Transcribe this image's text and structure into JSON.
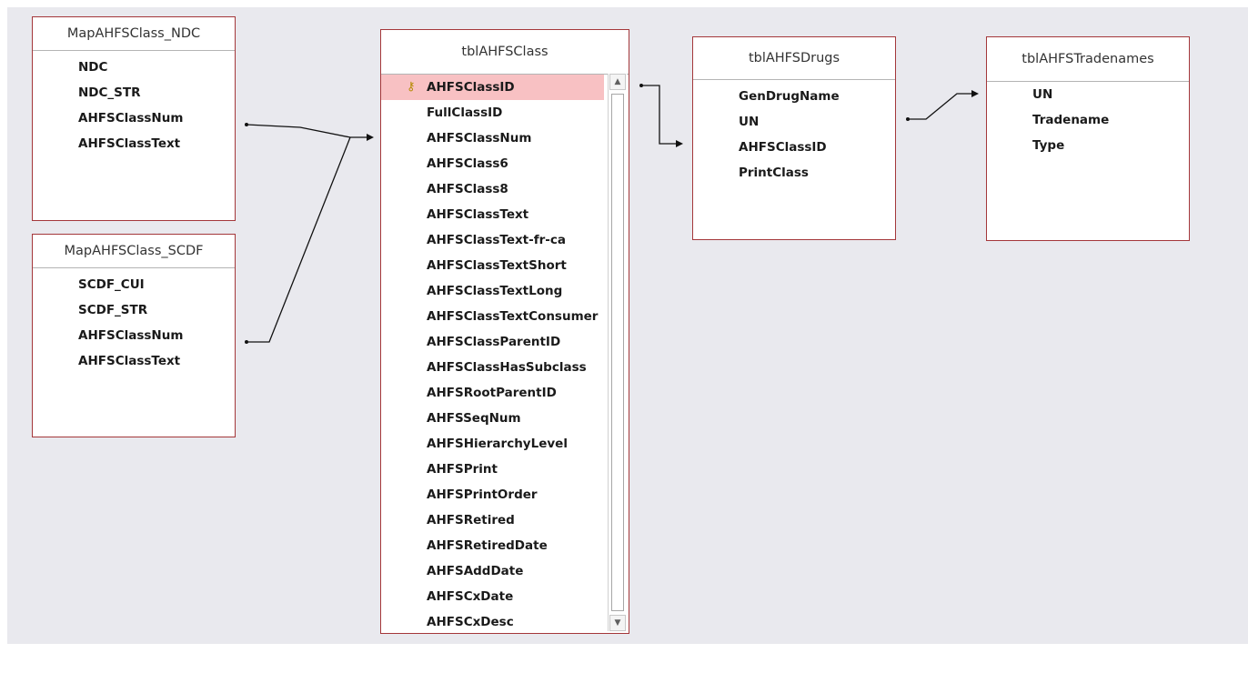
{
  "tables": {
    "map_ndc": {
      "title": "MapAHFSClass_NDC",
      "fields": [
        "NDC",
        "NDC_STR",
        "AHFSClassNum",
        "AHFSClassText"
      ]
    },
    "map_scdf": {
      "title": "MapAHFSClass_SCDF",
      "fields": [
        "SCDF_CUI",
        "SCDF_STR",
        "AHFSClassNum",
        "AHFSClassText"
      ]
    },
    "ahfs_class": {
      "title": "tblAHFSClass",
      "fields": [
        "AHFSClassID",
        "FullClassID",
        "AHFSClassNum",
        "AHFSClass6",
        "AHFSClass8",
        "AHFSClassText",
        "AHFSClassText-fr-ca",
        "AHFSClassTextShort",
        "AHFSClassTextLong",
        "AHFSClassTextConsumer",
        "AHFSClassParentID",
        "AHFSClassHasSubclass",
        "AHFSRootParentID",
        "AHFSSeqNum",
        "AHFSHierarchyLevel",
        "AHFSPrint",
        "AHFSPrintOrder",
        "AHFSRetired",
        "AHFSRetiredDate",
        "AHFSAddDate",
        "AHFSCxDate",
        "AHFSCxDesc"
      ],
      "selected_field": "AHFSClassID",
      "key_icon": "key-icon"
    },
    "ahfs_drugs": {
      "title": "tblAHFSDrugs",
      "fields": [
        "GenDrugName",
        "UN",
        "AHFSClassID",
        "PrintClass"
      ]
    },
    "ahfs_tradenames": {
      "title": "tblAHFSTradenames",
      "fields": [
        "UN",
        "Tradename",
        "Type"
      ]
    }
  },
  "colors": {
    "border": "#a4373a",
    "selected_row": "#f8c1c3",
    "canvas": "#e9e9ee"
  }
}
